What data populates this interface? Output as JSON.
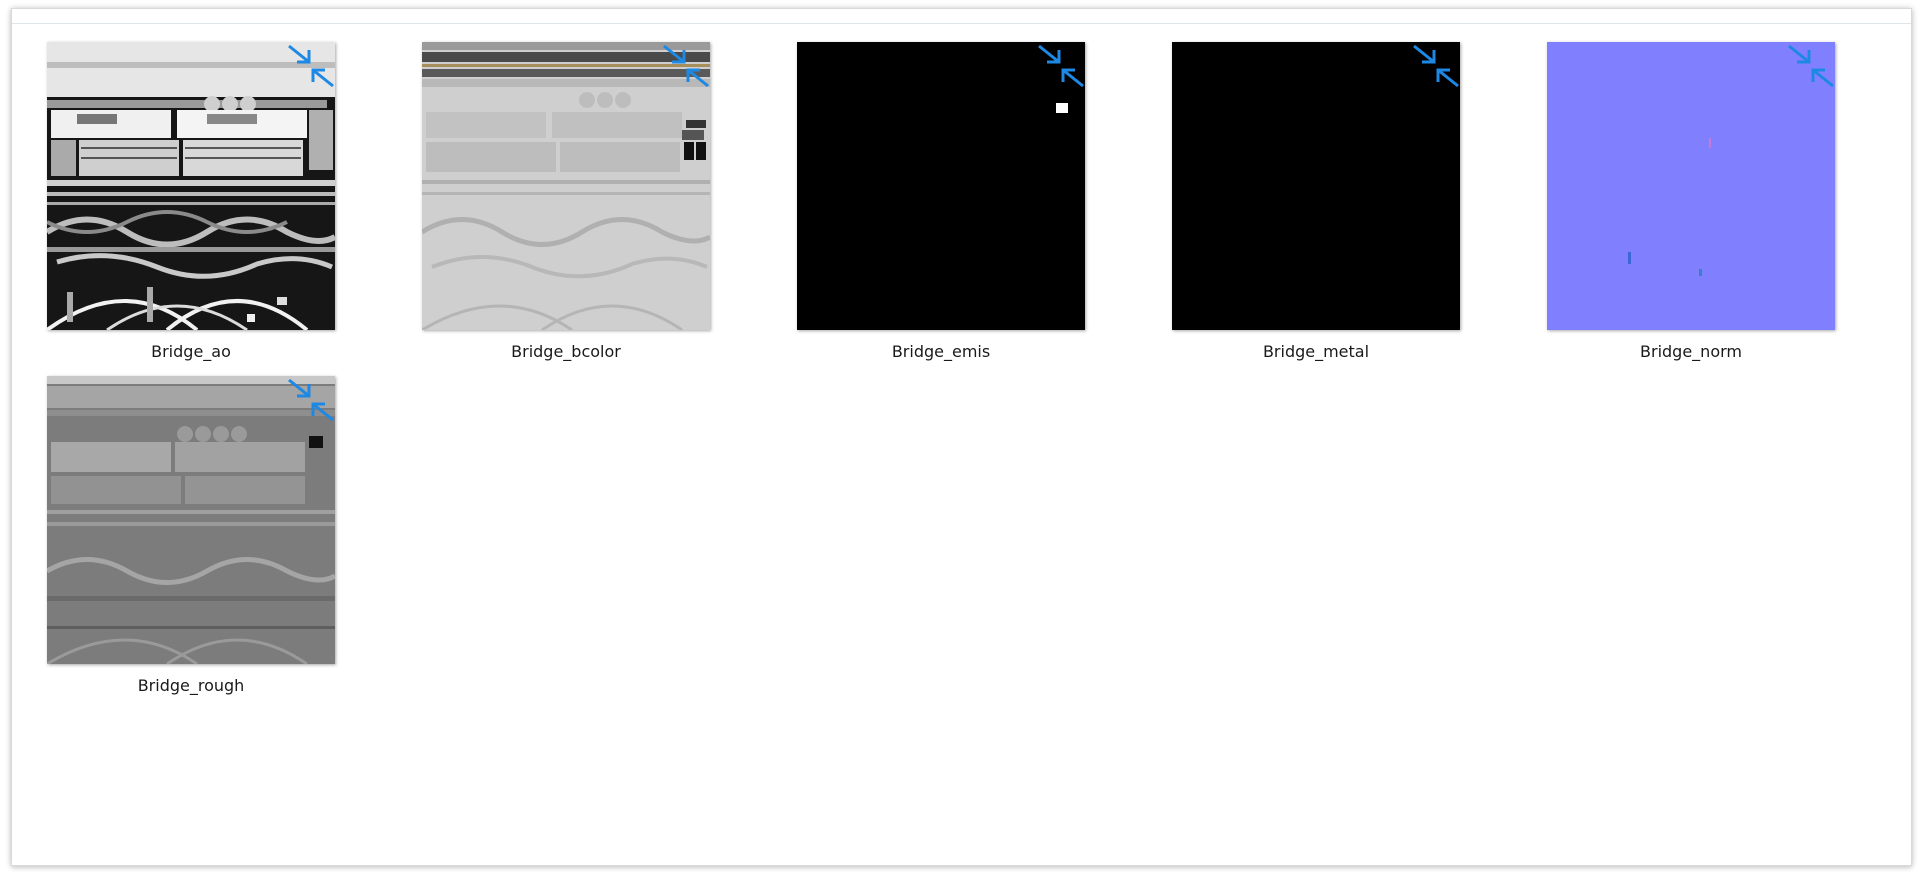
{
  "files": [
    {
      "label": "Bridge_ao",
      "icon": "compressed-arrows-icon"
    },
    {
      "label": "Bridge_bcolor",
      "icon": "compressed-arrows-icon"
    },
    {
      "label": "Bridge_emis",
      "icon": "compressed-arrows-icon"
    },
    {
      "label": "Bridge_metal",
      "icon": "compressed-arrows-icon"
    },
    {
      "label": "Bridge_norm",
      "icon": "compressed-arrows-icon"
    },
    {
      "label": "Bridge_rough",
      "icon": "compressed-arrows-icon"
    }
  ],
  "colors": {
    "ao_bg": "#1a1a1a",
    "bcolor_bg": "#c8c8c8",
    "emis_bg": "#000000",
    "metal_bg": "#000000",
    "norm_bg": "#8080ff",
    "rough_bg": "#7a7a7a",
    "icon_blue": "#1e88e5"
  }
}
